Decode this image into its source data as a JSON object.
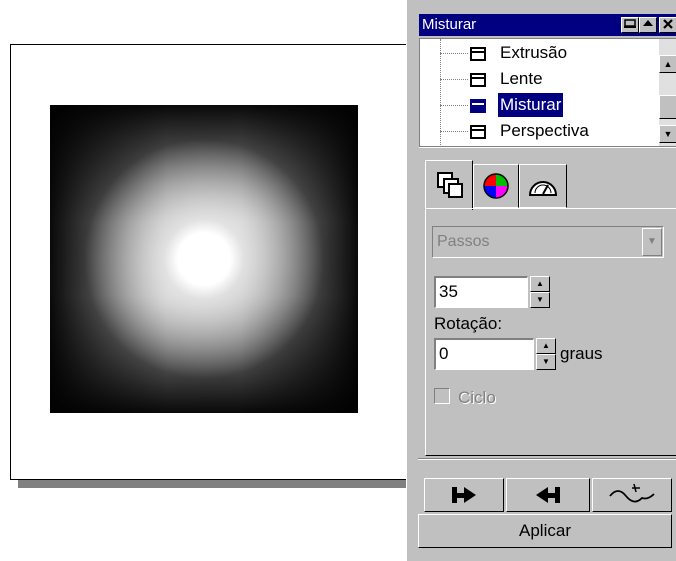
{
  "docker": {
    "title": "Misturar",
    "list_items": [
      {
        "label": "Extrusão",
        "selected": false,
        "icon": "object-effect-icon"
      },
      {
        "label": "Lente",
        "selected": false,
        "icon": "object-effect-icon"
      },
      {
        "label": "Misturar",
        "selected": true,
        "icon": "object-effect-icon"
      },
      {
        "label": "Perspectiva",
        "selected": false,
        "icon": "object-effect-icon"
      }
    ],
    "tabs": [
      "blend-steps-tab",
      "color-wheel-tab",
      "acceleration-tab"
    ],
    "mode_select": {
      "value": "Passos",
      "enabled": false
    },
    "steps_value": "35",
    "rotation_label": "Rotação:",
    "rotation_value": "0",
    "rotation_unit": "graus",
    "loop_label": "Ciclo",
    "apply_label": "Aplicar"
  },
  "colors": {
    "title_bar": "#000080",
    "panel_bg": "#c0c0c0",
    "selection": "#000080"
  }
}
